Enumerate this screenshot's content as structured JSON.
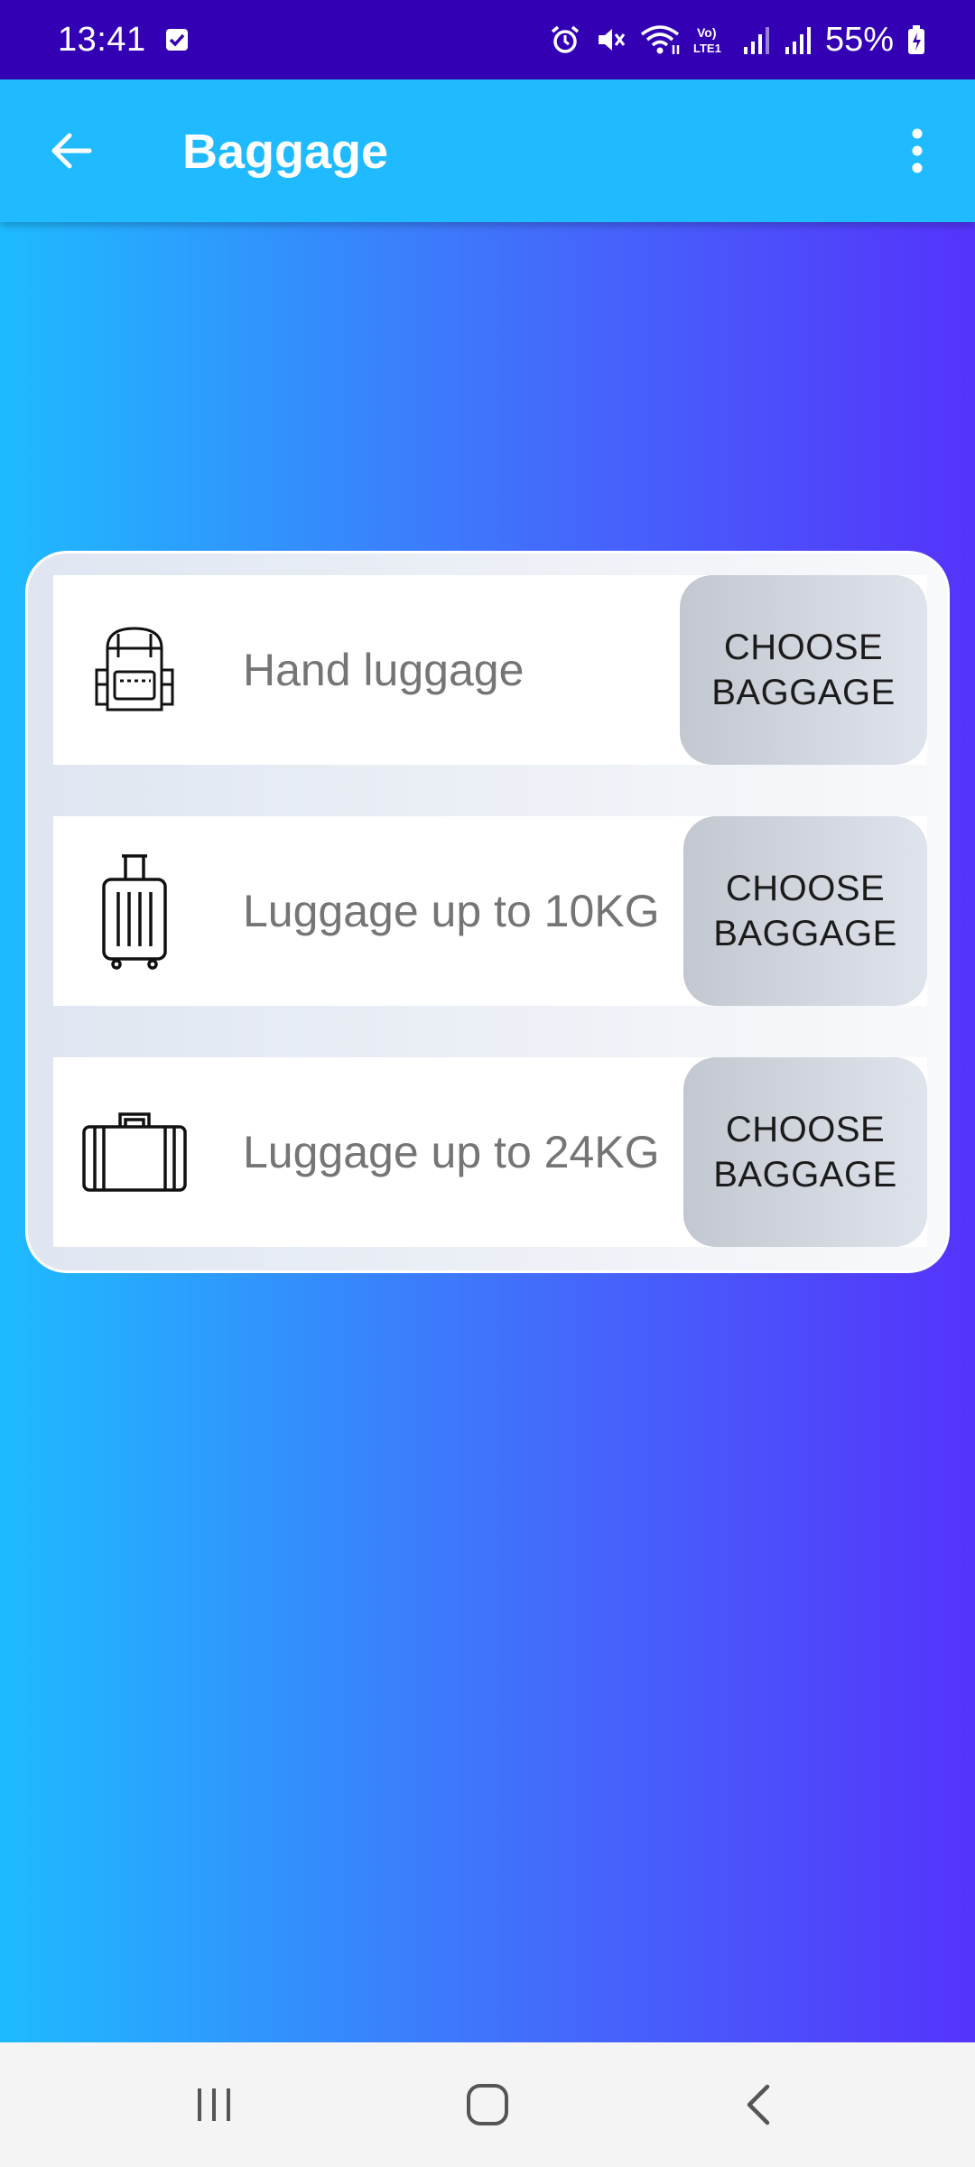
{
  "status_bar": {
    "time": "13:41",
    "battery": "55%",
    "icons": [
      "checkbox-icon",
      "alarm-icon",
      "mute-icon",
      "wifi-icon",
      "volte-icon",
      "signal-icon",
      "signal-icon",
      "battery-charging-icon"
    ],
    "lte_label": "Vo) LTE1"
  },
  "app_bar": {
    "title": "Baggage",
    "back_icon": "arrow-back-icon",
    "menu_icon": "more-vert-icon"
  },
  "baggage_options": [
    {
      "label": "Hand luggage",
      "icon": "backpack-icon",
      "button": "CHOOSE\nBAGGAGE"
    },
    {
      "label": "Luggage up to 10KG",
      "icon": "trolley-suitcase-icon",
      "button": "CHOOSE\nBAGGAGE"
    },
    {
      "label": "Luggage up to 24KG",
      "icon": "suitcase-icon",
      "button": "CHOOSE\nBAGGAGE"
    }
  ],
  "nav_bar": {
    "recents": "recents-icon",
    "home": "home-icon",
    "back": "nav-back-icon"
  },
  "colors": {
    "status_bar": "#3300b3",
    "app_bar": "#1fbaff",
    "gradient_start": "#1ebbff",
    "gradient_end": "#5533fb",
    "button_bg": "#cfd3db"
  }
}
